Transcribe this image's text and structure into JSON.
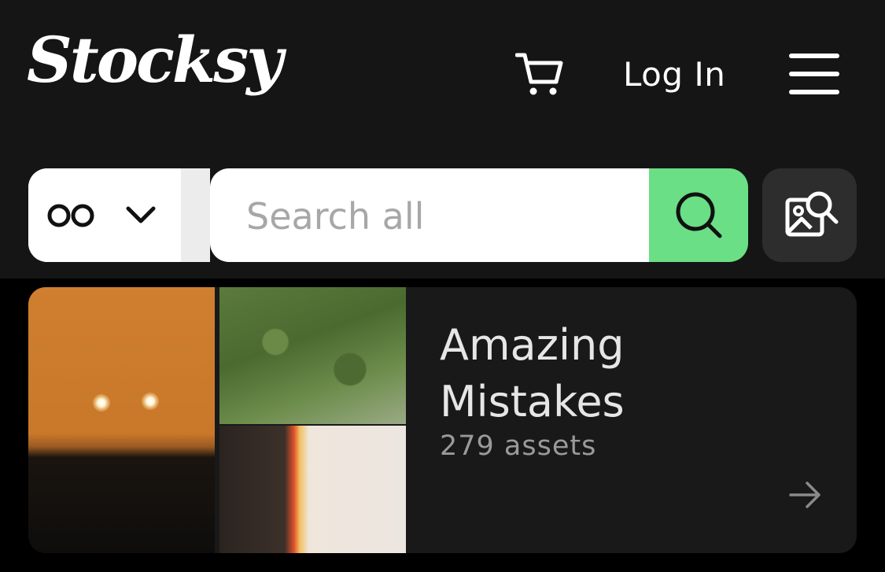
{
  "header": {
    "logo_text": "Stocksy",
    "login_label": "Log In",
    "icons": {
      "cart": "cart-icon",
      "menu": "hamburger-menu-icon"
    }
  },
  "search": {
    "scope_icon": "infinity-icon",
    "scope_dropdown_icon": "chevron-down-icon",
    "placeholder": "Search all",
    "value": "",
    "search_button_icon": "search-icon",
    "visual_search_icon": "image-search-icon",
    "search_button_color": "#6adf85"
  },
  "collection_card": {
    "title": "Amazing Mistakes",
    "count_label": "279 assets",
    "arrow_icon": "arrow-right-icon"
  }
}
